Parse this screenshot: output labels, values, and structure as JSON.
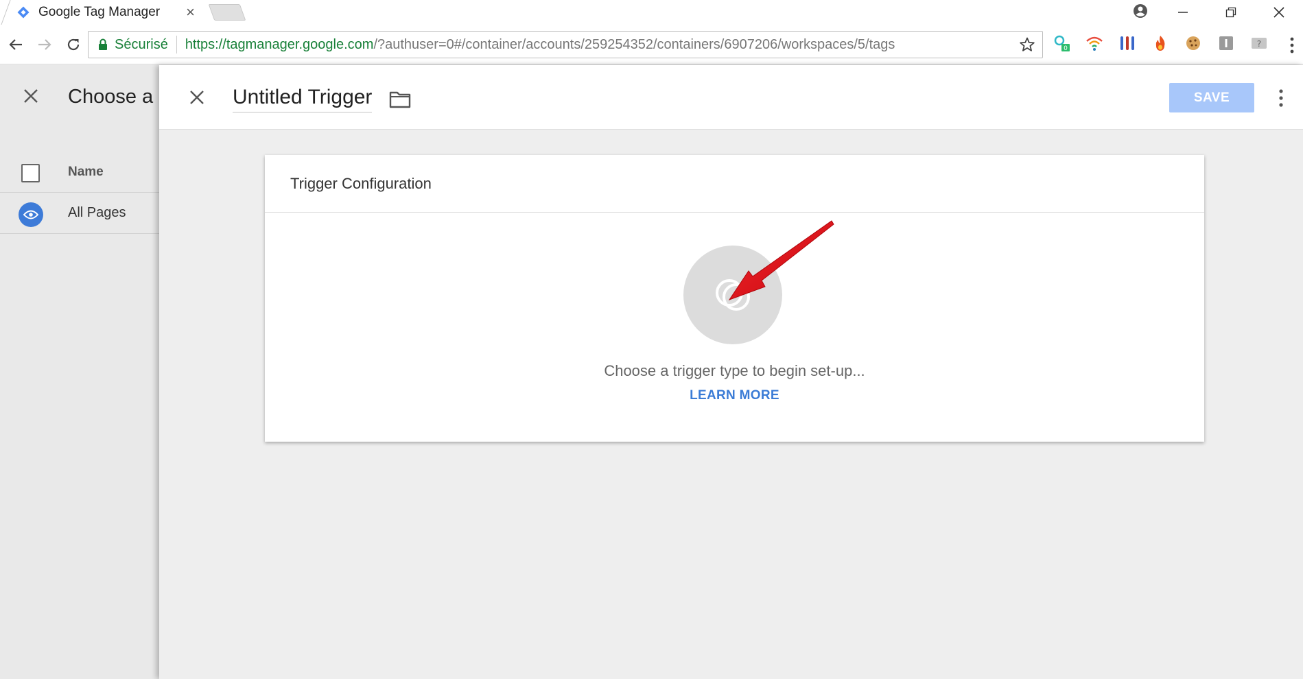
{
  "browser": {
    "tab_title": "Google Tag Manager",
    "tab_close": "×",
    "secure_label": "Sécurisé",
    "url_host": "https://tagmanager.google.com",
    "url_rest": "/?authuser=0#/container/accounts/259254352/containers/6907206/workspaces/5/tags",
    "extensions": [
      "search-extension",
      "wifi-extension",
      "tubes-extension",
      "fire-extension",
      "cookie-extension",
      "pause-extension",
      "help-extension"
    ],
    "ext_badge": "0"
  },
  "left_panel": {
    "title": "Choose a",
    "column_name": "Name",
    "items": [
      {
        "label": "All Pages"
      }
    ]
  },
  "trigger_editor": {
    "title": "Untitled Trigger",
    "save_label": "SAVE",
    "card_title": "Trigger Configuration",
    "message": "Choose a trigger type to begin set-up...",
    "learn_more": "LEARN MORE"
  },
  "colors": {
    "accent_blue": "#3b7cd6",
    "save_disabled": "#a8c7fa",
    "annotation_arrow": "#e4141b",
    "secure_green": "#188038"
  }
}
